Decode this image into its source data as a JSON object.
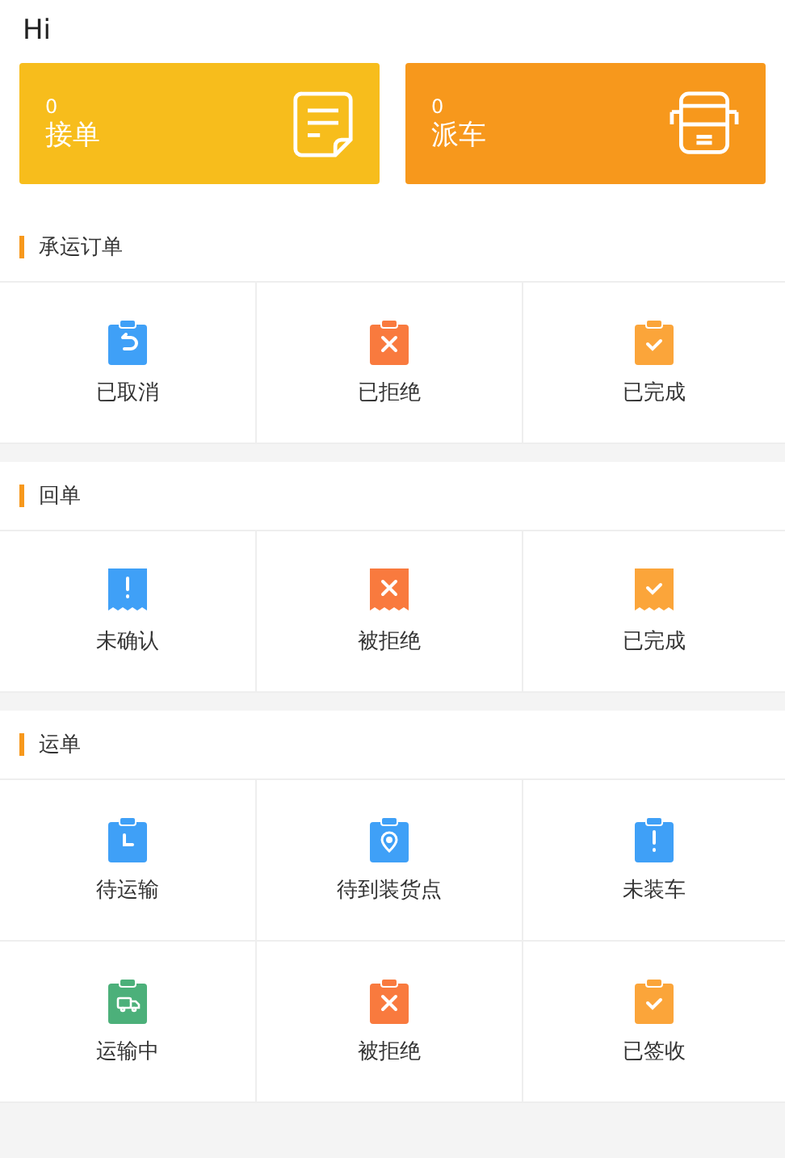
{
  "greeting": "Hi",
  "cards": [
    {
      "count": "0",
      "label": "接单",
      "color": "#f7bd1c"
    },
    {
      "count": "0",
      "label": "派车",
      "color": "#f7981c"
    }
  ],
  "sections": [
    {
      "title": "承运订单",
      "items": [
        {
          "label": "已取消",
          "color": "#3fa0f7",
          "kind": "undo"
        },
        {
          "label": "已拒绝",
          "color": "#f97a3e",
          "kind": "cross"
        },
        {
          "label": "已完成",
          "color": "#fba53a",
          "kind": "check"
        }
      ]
    },
    {
      "title": "回单",
      "items": [
        {
          "label": "未确认",
          "color": "#3fa0f7",
          "kind": "alert"
        },
        {
          "label": "被拒绝",
          "color": "#f97a3e",
          "kind": "cross"
        },
        {
          "label": "已完成",
          "color": "#fba53a",
          "kind": "check"
        }
      ]
    },
    {
      "title": "运单",
      "items": [
        {
          "label": "待运输",
          "color": "#3fa0f7",
          "kind": "clock"
        },
        {
          "label": "待到装货点",
          "color": "#3fa0f7",
          "kind": "pin"
        },
        {
          "label": "未装车",
          "color": "#3fa0f7",
          "kind": "alert"
        },
        {
          "label": "运输中",
          "color": "#4cb07a",
          "kind": "truck"
        },
        {
          "label": "被拒绝",
          "color": "#f97a3e",
          "kind": "cross"
        },
        {
          "label": "已签收",
          "color": "#fba53a",
          "kind": "check"
        }
      ]
    }
  ]
}
